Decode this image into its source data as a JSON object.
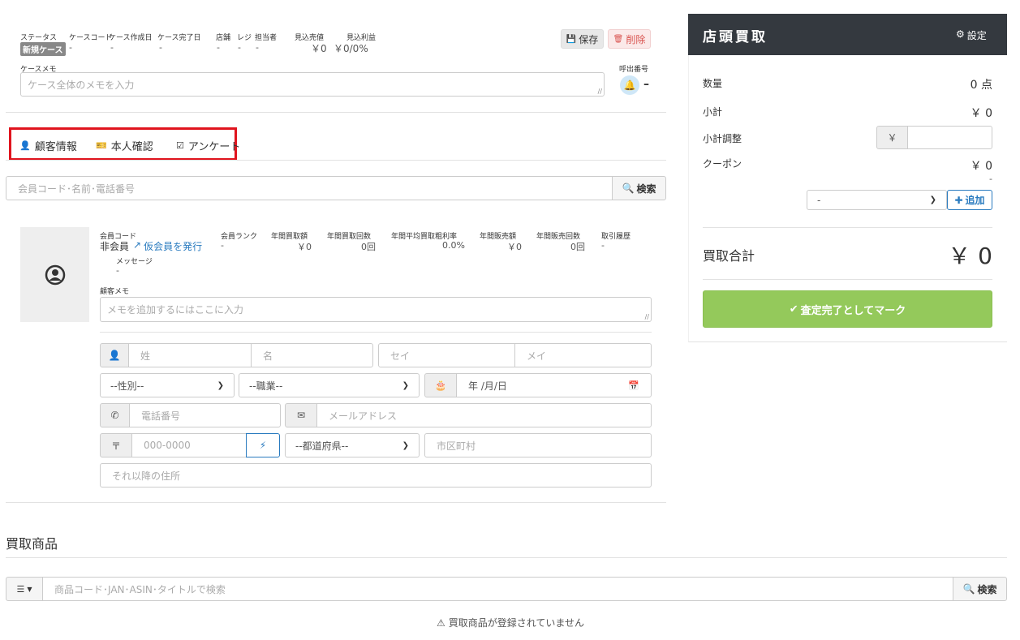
{
  "case": {
    "labels": {
      "status": "ステータス",
      "case_code": "ケースコード",
      "created": "ケース作成日",
      "completed": "ケース完了日",
      "store": "店舗",
      "register": "レジ",
      "staff": "担当者",
      "estimated_sales": "見込売値",
      "estimated_profit": "見込利益"
    },
    "status_badge": "新規ケース",
    "case_code_value": "-",
    "created_value": "-",
    "completed_value": "-",
    "store_value": "-",
    "register_value": "-",
    "staff_value": "-",
    "estimated_sales_value": "￥0",
    "estimated_profit_value": "￥0/0%",
    "save_label": "保存",
    "delete_label": "削除",
    "memo_label": "ケースメモ",
    "memo_placeholder": "ケース全体のメモを入力",
    "call_number_label": "呼出番号",
    "call_number_value": "–"
  },
  "tabs": [
    {
      "label": "顧客情報",
      "icon": "user-icon"
    },
    {
      "label": "本人確認",
      "icon": "id-card-icon"
    },
    {
      "label": "アンケート",
      "icon": "checkbox-icon"
    }
  ],
  "member_search": {
    "placeholder": "会員コード･名前･電話番号",
    "button_label": "検索"
  },
  "customer": {
    "member_code_label": "会員コード",
    "member_code_value": "非会員",
    "issue_link": "仮会員を発行",
    "message_label": "メッセージ",
    "message_value": "-",
    "stats": [
      {
        "label": "会員ランク",
        "value": "-"
      },
      {
        "label": "年間買取額",
        "value": "￥0"
      },
      {
        "label": "年間買取回数",
        "value": "0回"
      },
      {
        "label": "年間平均買取粗利率",
        "value": "0.0%"
      },
      {
        "label": "年間販売額",
        "value": "￥0"
      },
      {
        "label": "年間販売回数",
        "value": "0回"
      },
      {
        "label": "取引履歴",
        "value": "-"
      }
    ],
    "memo_label": "顧客メモ",
    "memo_placeholder": "メモを追加するにはここに入力"
  },
  "form": {
    "last_name": "姓",
    "first_name": "名",
    "last_kana": "セイ",
    "first_kana": "メイ",
    "gender": "--性別--",
    "occupation": "--職業--",
    "birthday": "年 /月/日",
    "phone": "電話番号",
    "email": "メールアドレス",
    "postal_prefix": "〒",
    "postal": "000-0000",
    "prefecture": "--都道府県--",
    "city": "市区町村",
    "address": "それ以降の住所"
  },
  "items": {
    "title": "買取商品",
    "search_placeholder": "商品コード･JAN･ASIN･タイトルで検索",
    "search_button": "検索",
    "empty_message": "買取商品が登録されていません"
  },
  "panel": {
    "title": "店頭買取",
    "settings_label": "設定",
    "quantity_label": "数量",
    "quantity_value": "0 点",
    "subtotal_label": "小計",
    "subtotal_value": "￥ 0",
    "adjust_label": "小計調整",
    "adjust_prefix": "￥",
    "coupon_label": "クーポン",
    "coupon_value": "￥ 0",
    "coupon_sub": "-",
    "coupon_select": "-",
    "add_label": "追加",
    "total_label": "買取合計",
    "total_value": "￥ 0",
    "complete_label": "査定完了としてマーク"
  },
  "colors": {
    "highlight": "#e0141e",
    "panel_header": "#34393f",
    "complete_btn": "#94c95b",
    "link": "#2a7bbf",
    "badge": "#888888",
    "delete_text": "#d9534f"
  }
}
